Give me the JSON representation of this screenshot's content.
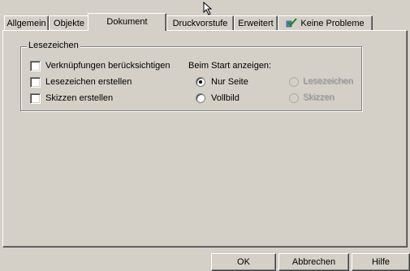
{
  "tabs": [
    {
      "label": "Allgemein"
    },
    {
      "label": "Objekte"
    },
    {
      "label": "Dokument",
      "active": true
    },
    {
      "label": "Druckvorstufe"
    },
    {
      "label": "Erweitert"
    },
    {
      "label": "Keine Probleme",
      "icon": "checkmark-icon"
    }
  ],
  "bookmarks_group": {
    "title": "Lesezeichen",
    "checkboxes": [
      {
        "label": "Verknüpfungen berücksichtigen",
        "checked": false
      },
      {
        "label": "Lesezeichen erstellen",
        "checked": false
      },
      {
        "label": "Skizzen erstellen",
        "checked": false
      }
    ],
    "start_view": {
      "label": "Beim Start anzeigen:",
      "options": [
        {
          "label": "Nur Seite",
          "selected": true,
          "enabled": true
        },
        {
          "label": "Vollbild",
          "selected": false,
          "enabled": true
        },
        {
          "label": "Lesezeichen",
          "selected": false,
          "enabled": false
        },
        {
          "label": "Skizzen",
          "selected": false,
          "enabled": false
        }
      ]
    }
  },
  "buttons": {
    "ok": "OK",
    "cancel": "Abbrechen",
    "help": "Hilfe"
  },
  "colors": {
    "face": "#d4d0c8",
    "shadow": "#808080",
    "highlight": "#ffffff",
    "disabled_text": "#a0a0a0"
  }
}
